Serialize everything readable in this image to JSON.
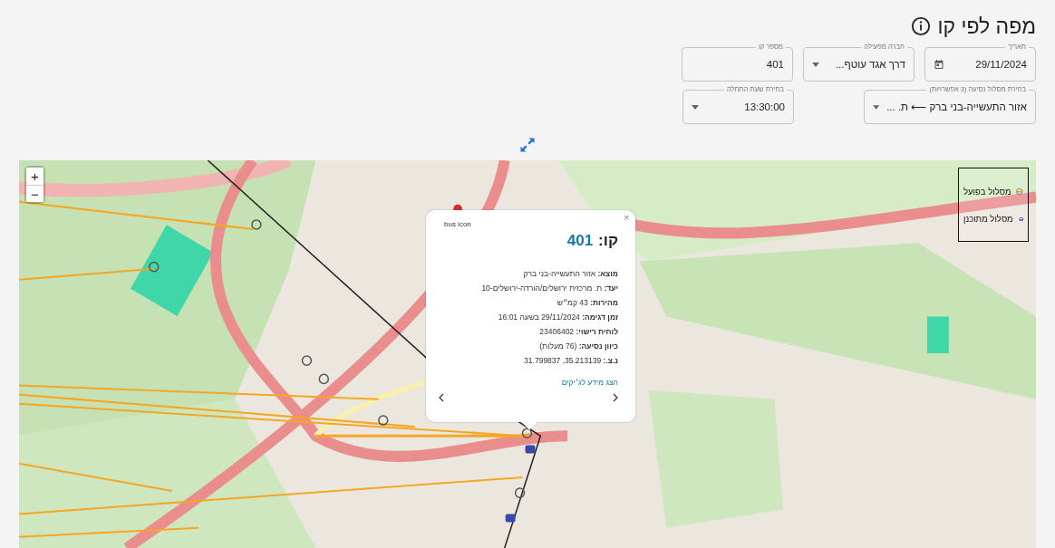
{
  "title": "מפה לפי קו",
  "fields_row1": [
    {
      "kind": "date",
      "label": "תאריך",
      "value": "29/11/2024"
    },
    {
      "kind": "select",
      "label": "חברה מפעילה",
      "value": "דרך אגד עוטף..."
    },
    {
      "kind": "text",
      "label": "מספר קו",
      "value": "401"
    }
  ],
  "fields_row2": [
    {
      "kind": "select",
      "label": "בחירת מסלול נסיעה (3 אפשרויות)",
      "value": "אזור התעשייה-בני ברק ⟵ ת. ..."
    },
    {
      "kind": "select",
      "label": "בחירת שעת התחלה",
      "value": "13:30:00"
    }
  ],
  "map": {
    "zoom": [
      "+",
      "−"
    ],
    "legend": [
      {
        "kind": "actual",
        "label": "מסלול בפועל"
      },
      {
        "kind": "planned",
        "label": "מסלול מתוכנן"
      }
    ],
    "popup": {
      "close": "×",
      "image_alt": "bus icon",
      "title_label": "קו:",
      "line": "401",
      "rows": [
        {
          "label": "מוצא:",
          "value": "אזור התעשייה-בני ברק"
        },
        {
          "label": "יעד:",
          "value": "ת. מרכזית ירושלים/הורדה-ירושלים-10"
        },
        {
          "label": "מהירות:",
          "value": "43 קמ״ש"
        },
        {
          "label": "זמן דגימה:",
          "value": "29/11/2024 בשעה 16:01"
        },
        {
          "label": "לוחית רישוי:",
          "value": "23406402"
        },
        {
          "label": "כיוון נסיעה:",
          "value": "(76 מעלות)"
        },
        {
          "label": "נ.צ.:",
          "value": "35.213139, 31.799837"
        }
      ],
      "link": "הצג מידע לג׳יקים"
    }
  }
}
